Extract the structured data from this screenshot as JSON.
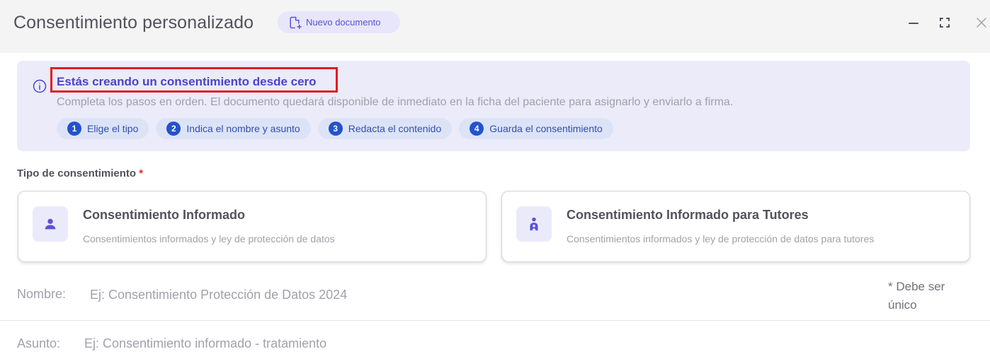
{
  "header": {
    "title": "Consentimiento personalizado",
    "badge_label": "Nuevo documento",
    "badge_icon": "file-plus-icon",
    "controls": [
      "minimize-icon",
      "fullscreen-icon",
      "close-icon"
    ]
  },
  "info": {
    "icon": "info-icon",
    "title": "Estás creando un consentimiento desde cero",
    "description": "Completa los pasos en orden. El documento quedará disponible de inmediato en la ficha del paciente para asignarlo y enviarlo a firma.",
    "steps": [
      {
        "num": "1",
        "label": "Elige el tipo"
      },
      {
        "num": "2",
        "label": "Indica el nombre y asunto"
      },
      {
        "num": "3",
        "label": "Redacta el contenido"
      },
      {
        "num": "4",
        "label": "Guarda el consentimiento"
      }
    ]
  },
  "type_section": {
    "label": "Tipo de consentimiento",
    "required_mark": "*",
    "options": [
      {
        "icon": "user-icon",
        "title": "Consentimiento Informado",
        "subtitle": "Consentimientos informados y ley de protección de datos"
      },
      {
        "icon": "parent-child-icon",
        "title": "Consentimiento Informado para Tutores",
        "subtitle": "Consentimientos informados y ley de protección de datos para tutores"
      }
    ]
  },
  "fields": {
    "name": {
      "label": "Nombre:",
      "value": "",
      "placeholder": "Ej: Consentimiento Protección de Datos 2024",
      "hint": "* Debe ser único"
    },
    "subject": {
      "label": "Asunto:",
      "value": "",
      "placeholder": "Ej: Consentimiento informado - tratamiento"
    }
  },
  "colors": {
    "accent": "#4b43c8",
    "step_badge": "#2352cc",
    "required": "#dc2626",
    "highlight": "#e01b24"
  }
}
